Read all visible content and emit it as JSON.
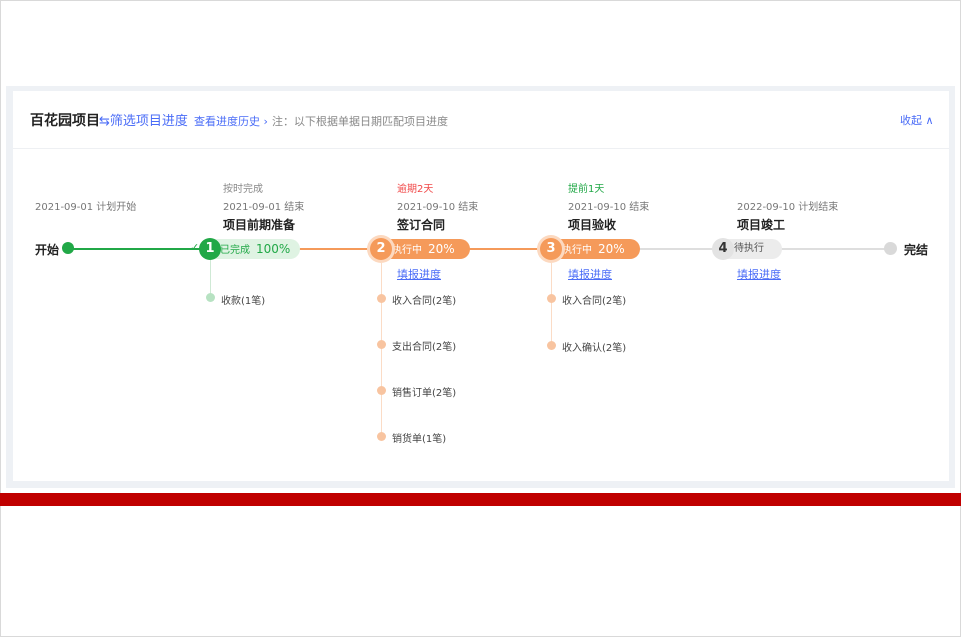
{
  "header": {
    "project_title": "百花园项目",
    "filter_label": "筛选项目进度",
    "history_label": "查看进度历史",
    "note": "注：以下根据单据日期匹配项目进度",
    "collapse_label": "收起"
  },
  "timeline": {
    "start": {
      "label": "开始",
      "date": "2021-09-01 计划开始"
    },
    "end": {
      "label": "完结"
    },
    "stages": [
      {
        "number": "1",
        "status_note": "按时完成",
        "date": "2021-09-01 结束",
        "name": "项目前期准备",
        "state": "已完成",
        "progress": "100%",
        "sub_items": [
          "收款(1笔)"
        ]
      },
      {
        "number": "2",
        "status_note": "逾期2天",
        "date": "2021-09-10 结束",
        "name": "签订合同",
        "state": "执行中",
        "progress": "20%",
        "fill_link": "填报进度",
        "sub_items": [
          "收入合同(2笔)",
          "支出合同(2笔)",
          "销售订单(2笔)",
          "销货单(1笔)"
        ]
      },
      {
        "number": "3",
        "status_note": "提前1天",
        "date": "2021-09-10 结束",
        "name": "项目验收",
        "state": "执行中",
        "progress": "20%",
        "fill_link": "填报进度",
        "sub_items": [
          "收入合同(2笔)",
          "收入确认(2笔)"
        ]
      },
      {
        "number": "4",
        "date": "2022-09-10 计划结束",
        "name": "项目竣工",
        "state": "待执行",
        "fill_link": "填报进度"
      }
    ]
  },
  "colors": {
    "done": "#21a847",
    "active": "#f59a5a",
    "pending": "#d9d9d9",
    "link": "#4a6cf7",
    "overdue": "#f04848"
  }
}
